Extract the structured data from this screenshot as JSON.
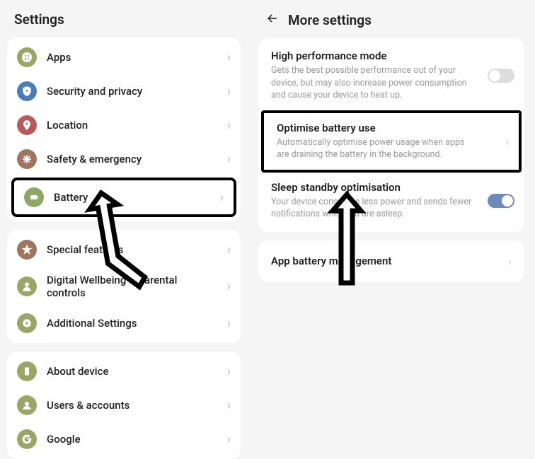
{
  "left": {
    "title": "Settings",
    "groups": [
      {
        "items": [
          {
            "id": "apps",
            "label": "Apps",
            "color": "ic-olive",
            "icon": "grid"
          },
          {
            "id": "security",
            "label": "Security and privacy",
            "color": "ic-blue",
            "icon": "shield"
          },
          {
            "id": "location",
            "label": "Location",
            "color": "ic-red",
            "icon": "pin"
          },
          {
            "id": "safety",
            "label": "Safety & emergency",
            "color": "ic-brown",
            "icon": "asterisk"
          },
          {
            "id": "battery",
            "label": "Battery",
            "color": "ic-green",
            "icon": "battery",
            "highlighted": true
          }
        ]
      },
      {
        "items": [
          {
            "id": "special",
            "label": "Special features",
            "color": "ic-brown",
            "icon": "star"
          },
          {
            "id": "wellbeing",
            "label": "Digital Wellbeing & parental controls",
            "color": "ic-olive",
            "icon": "wellbeing"
          },
          {
            "id": "additional",
            "label": "Additional Settings",
            "color": "ic-olive",
            "icon": "gear"
          }
        ]
      },
      {
        "items": [
          {
            "id": "about",
            "label": "About device",
            "color": "ic-olive",
            "icon": "device"
          },
          {
            "id": "users",
            "label": "Users & accounts",
            "color": "ic-olive",
            "icon": "user"
          },
          {
            "id": "google",
            "label": "Google",
            "color": "ic-olive",
            "icon": "google"
          }
        ]
      }
    ]
  },
  "right": {
    "title": "More settings",
    "settings": [
      {
        "id": "highperf",
        "title": "High performance mode",
        "desc": "Gets the best possible performance out of your device, but may also increase power consumption and cause your device to heat up.",
        "toggle": false,
        "toggleOn": false
      },
      {
        "id": "optimise",
        "title": "Optimise battery use",
        "desc": "Automatically optimise power usage when apps are draining the battery in the background.",
        "highlighted": true,
        "chevron": true
      },
      {
        "id": "sleep",
        "title": "Sleep standby optimisation",
        "desc": "Your device consumes less power and sends fewer notifications when you are asleep.",
        "toggle": true,
        "toggleOn": true
      }
    ],
    "appMgmt": {
      "label": "App battery management"
    }
  }
}
